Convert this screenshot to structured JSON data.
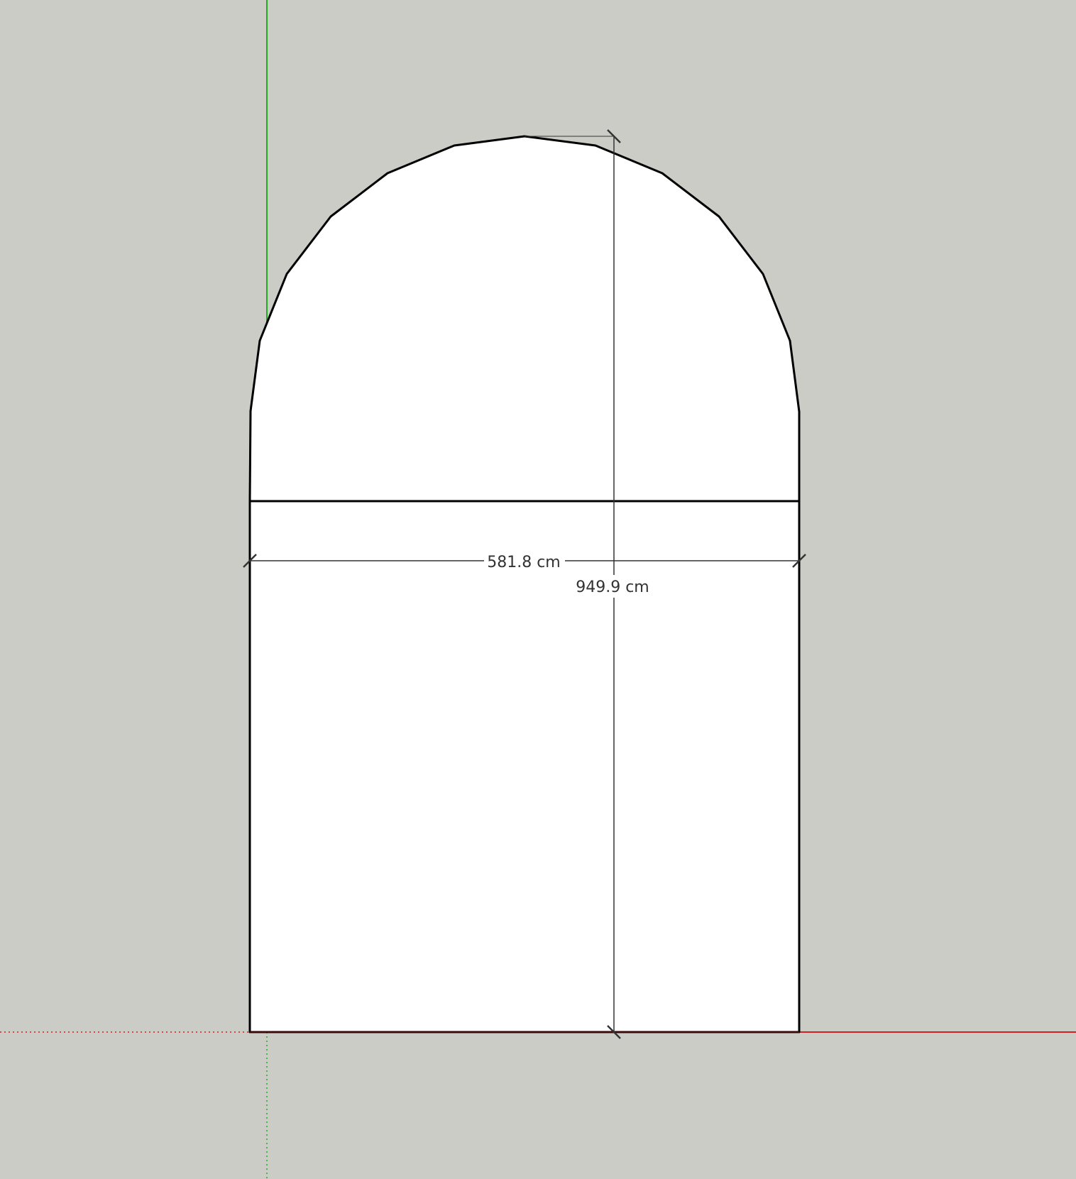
{
  "viewport": {
    "background": "#ccccc7",
    "face_color": "#ffffff",
    "edge_color": "#000000"
  },
  "axes": {
    "red_axis_color": "#cc2222",
    "green_axis_color": "#22aa22"
  },
  "dimensions": {
    "width_label": "581.8 cm",
    "height_label": "949.9 cm"
  }
}
